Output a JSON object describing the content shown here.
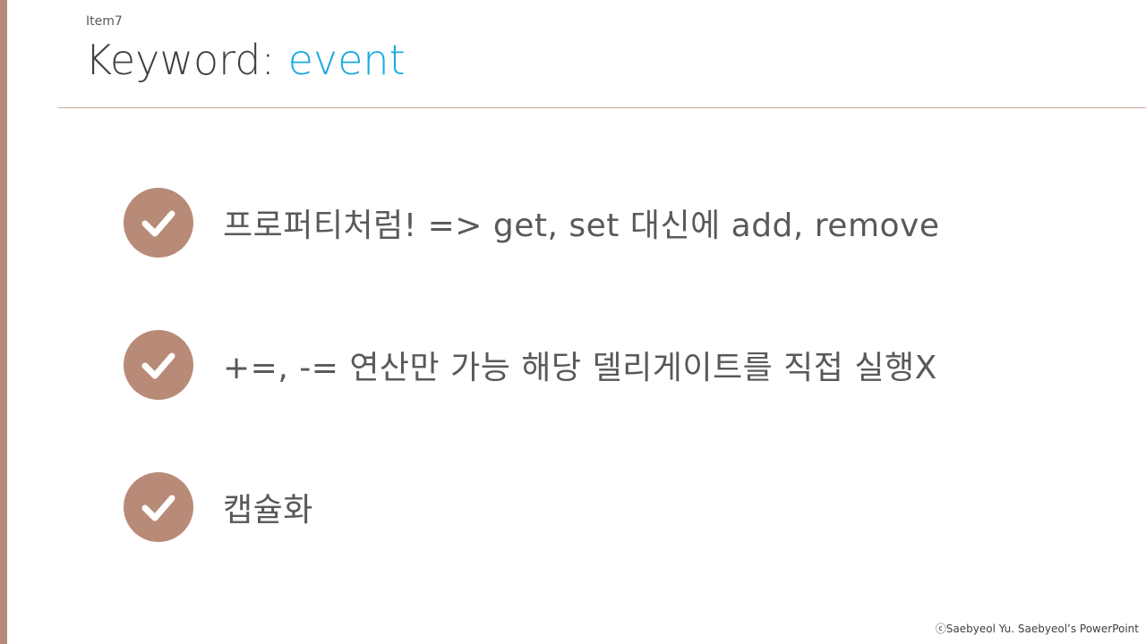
{
  "slide": {
    "item_label": "Item7",
    "title_prefix": "Keyword: ",
    "title_keyword": "event",
    "accent_color": "#b88a78",
    "keyword_color": "#1aa9e0"
  },
  "bullets": [
    {
      "icon": "check-icon",
      "text": "프로퍼티처럼! => get, set 대신에 add, remove"
    },
    {
      "icon": "check-icon",
      "text": "+=, -= 연산만 가능 해당 델리게이트를 직접 실행X"
    },
    {
      "icon": "check-icon",
      "text": "캡슐화"
    }
  ],
  "footer": {
    "copyright": "ⓒSaebyeol Yu. Saebyeol’s PowerPoint"
  }
}
